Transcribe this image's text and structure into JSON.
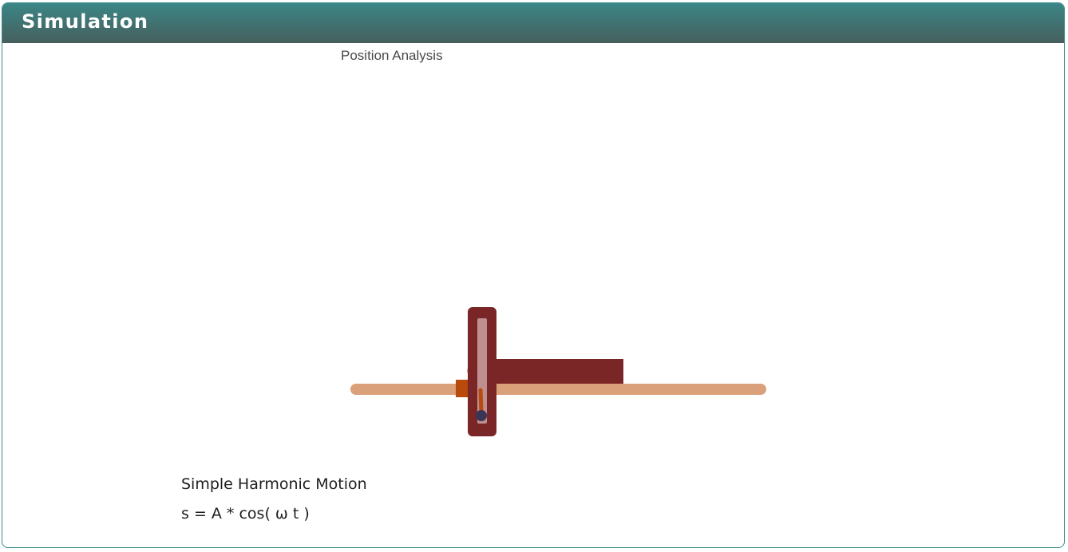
{
  "panel": {
    "title": "Simulation"
  },
  "simulation": {
    "title": "Position Analysis",
    "caption": "Simple Harmonic Motion",
    "equation": "s = A * cos( ω t )"
  },
  "colors": {
    "header_top": "#3b8686",
    "header_bottom": "#465f5d",
    "panel_border": "#3d8c8c",
    "rail": "#d9a07a",
    "yoke": "#7a2626",
    "slot": "#bf8f8f",
    "slider_block": "#b84a0c",
    "crank_pin": "#3a3555"
  }
}
